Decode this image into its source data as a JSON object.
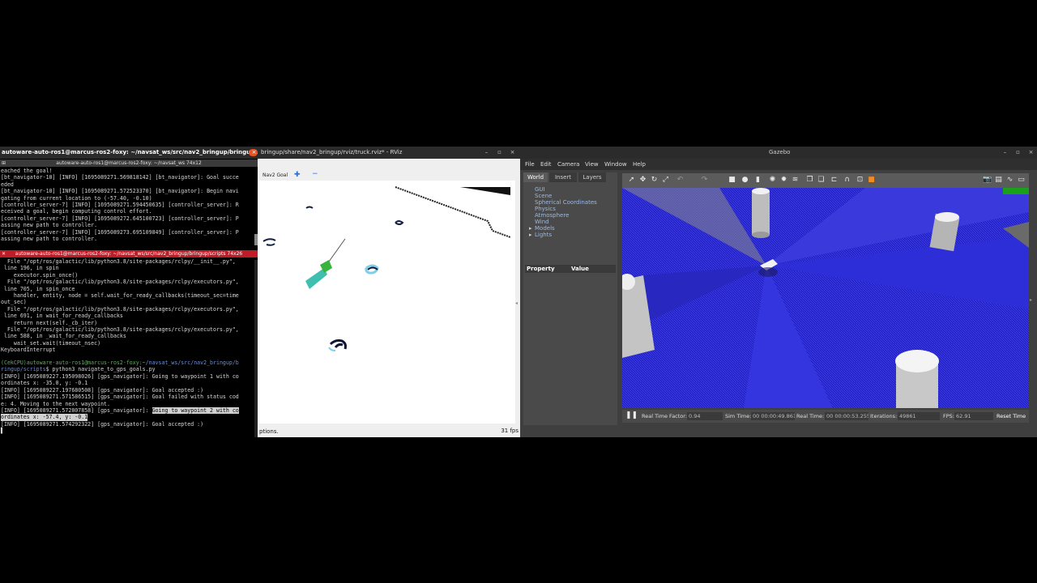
{
  "terminal": {
    "window_title": "autoware-auto-ros1@marcus-ros2-foxy: ~/navsat_ws/src/nav2_bringup/bringup/...",
    "tab_top_title": "autoware-auto-ros1@marcus-ros2-foxy: ~/navsat_ws 74x12",
    "tab_bottom_title": "autoware-auto-ros1@marcus-ros2-foxy: ~/navsat_ws/src/nav2_bringup/bringup/scripts 74x26",
    "top_lines": [
      "eached the goal!",
      "[bt_navigator-10] [INFO] [1695089271.569818142] [bt_navigator]: Goal succe",
      "eded",
      "[bt_navigator-10] [INFO] [1695089271.572523370] [bt_navigator]: Begin navi",
      "gating from current location to (-57.40, -0.10)",
      "[controller_server-7] [INFO] [1695089271.594450635] [controller_server]: R",
      "eceived a goal, begin computing control effort.",
      "[controller_server-7] [INFO] [1695089272.645100723] [controller_server]: P",
      "assing new path to controller.",
      "[controller_server-7] [INFO] [1695089273.695109849] [controller_server]: P",
      "assing new path to controller."
    ],
    "bottom_lines": [
      "  File \"/opt/ros/galactic/lib/python3.8/site-packages/rclpy/__init__.py\",",
      " line 196, in spin",
      "    executor.spin_once()",
      "  File \"/opt/ros/galactic/lib/python3.8/site-packages/rclpy/executors.py\",",
      " line 705, in spin_once",
      "    handler, entity, node = self.wait_for_ready_callbacks(timeout_sec=time",
      "out_sec)",
      "  File \"/opt/ros/galactic/lib/python3.8/site-packages/rclpy/executors.py\",",
      " line 691, in wait_for_ready_callbacks",
      "    return next(self._cb_iter)",
      "  File \"/opt/ros/galactic/lib/python3.8/site-packages/rclpy/executors.py\",",
      " line 588, in _wait_for_ready_callbacks",
      "    wait_set.wait(timeout_nsec)",
      "KeyboardInterrupt"
    ],
    "prompt_user": "(CekCPU)autoware-auto-ros1@marcus-ros2-foxy",
    "prompt_path": ":~/navsat_ws/src/nav2_bringup/b",
    "prompt_path2": "ringup/scripts",
    "command": "$ python3 navigate_to_gps_goals.py",
    "log_lines": [
      "[INFO] [1695089227.195098026] [gps_navigator]: Going to waypoint 1 with co",
      "ordinates x: -35.0, y: -0.1",
      "[INFO] [1695089227.197680508] [gps_navigator]: Goal accepted :)",
      "[INFO] [1695089271.571586515] [gps_navigator]: Goal failed with status cod",
      "e: 4. Moving to the next waypoint.",
      "[INFO] [1695089271.572807858] [gps_navigator]: ",
      "ordinates x: -57.4, y: -0.1",
      "[INFO] [1695089271.574292322] [gps_navigator]: Goal accepted :)"
    ],
    "highlighted_text": "Going to waypoint 2 with co"
  },
  "rviz": {
    "window_title": "bringup/share/nav2_bringup/rviz/truck.rviz* - RViz",
    "toolbar_goal_label": "Nav2 Goal",
    "status_text": "ptions.",
    "fps_text": "31 fps"
  },
  "gazebo": {
    "window_title": "Gazebo",
    "menu": [
      "File",
      "Edit",
      "Camera",
      "View",
      "Window",
      "Help"
    ],
    "tabs": [
      "World",
      "Insert",
      "Layers"
    ],
    "tree": [
      "GUI",
      "Scene",
      "Spherical Coordinates",
      "Physics",
      "Atmosphere",
      "Wind",
      "Models",
      "Lights"
    ],
    "props_header": [
      "Property",
      "Value"
    ],
    "bottom": {
      "rtf_label": "Real Time Factor:",
      "rtf_value": "0.94",
      "sim_label": "Sim Time:",
      "sim_value": "00 00:00:49.861",
      "real_label": "Real Time:",
      "real_value": "00 00:00:53.255",
      "iter_label": "Iterations:",
      "iter_value": "49861",
      "fps_label": "FPS:",
      "fps_value": "62.91",
      "reset_label": "Reset Time"
    }
  }
}
